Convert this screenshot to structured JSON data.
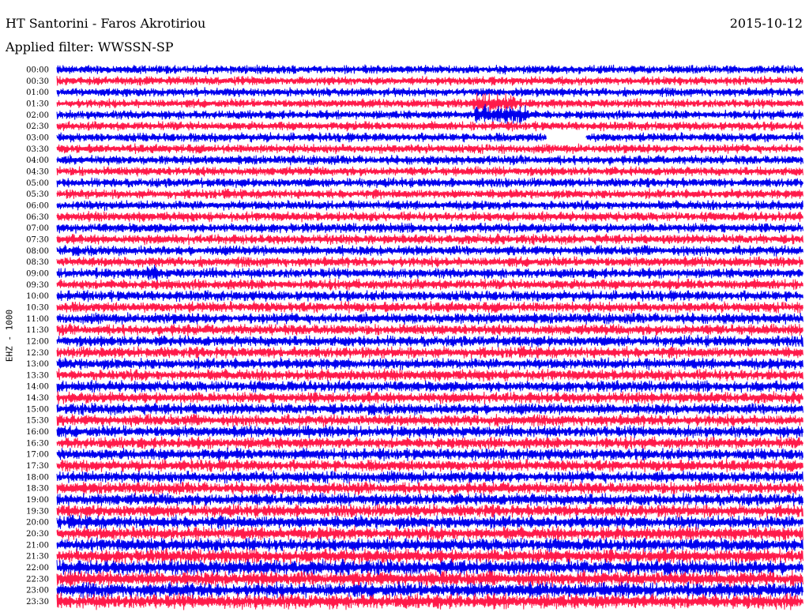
{
  "header": {
    "title": "HT Santorini - Faros Akrotiriou",
    "date": "2015-10-12",
    "filter": "Applied filter: WWSSN-SP"
  },
  "chart_data": {
    "type": "line",
    "channel_label": "EHZ - 1000",
    "trace_colors": [
      "#0000ee",
      "#ff1a4a"
    ],
    "row_labels": [
      "00:00",
      "00:30",
      "01:00",
      "01:30",
      "02:00",
      "02:30",
      "03:00",
      "03:30",
      "04:00",
      "04:30",
      "05:00",
      "05:30",
      "06:00",
      "06:30",
      "07:00",
      "07:30",
      "08:00",
      "08:30",
      "09:00",
      "09:30",
      "10:00",
      "10:30",
      "11:00",
      "11:30",
      "12:00",
      "12:30",
      "13:00",
      "13:30",
      "14:00",
      "14:30",
      "15:00",
      "15:30",
      "16:00",
      "16:30",
      "17:00",
      "17:30",
      "18:00",
      "18:30",
      "19:00",
      "19:30",
      "20:00",
      "20:30",
      "21:00",
      "21:30",
      "22:00",
      "22:30",
      "23:00",
      "23:30"
    ],
    "x_range_minutes": [
      0,
      30
    ],
    "events": [
      {
        "row": "01:30",
        "start_min": 16.7,
        "end_min": 18.5,
        "level": "strong"
      },
      {
        "row": "02:00",
        "start_min": 16.8,
        "end_min": 19.0,
        "level": "strong"
      },
      {
        "row": "03:00",
        "start_min": 19.7,
        "end_min": 21.3,
        "level": "gap"
      },
      {
        "row": "09:00",
        "start_min": 3.6,
        "end_min": 4.1,
        "level": "spike"
      }
    ],
    "noise_level": {
      "00:00": 0.55,
      "06:00": 0.6,
      "12:00": 0.7,
      "18:00": 0.75,
      "21:00": 0.85,
      "22:00": 0.95,
      "23:30": 0.95
    }
  }
}
